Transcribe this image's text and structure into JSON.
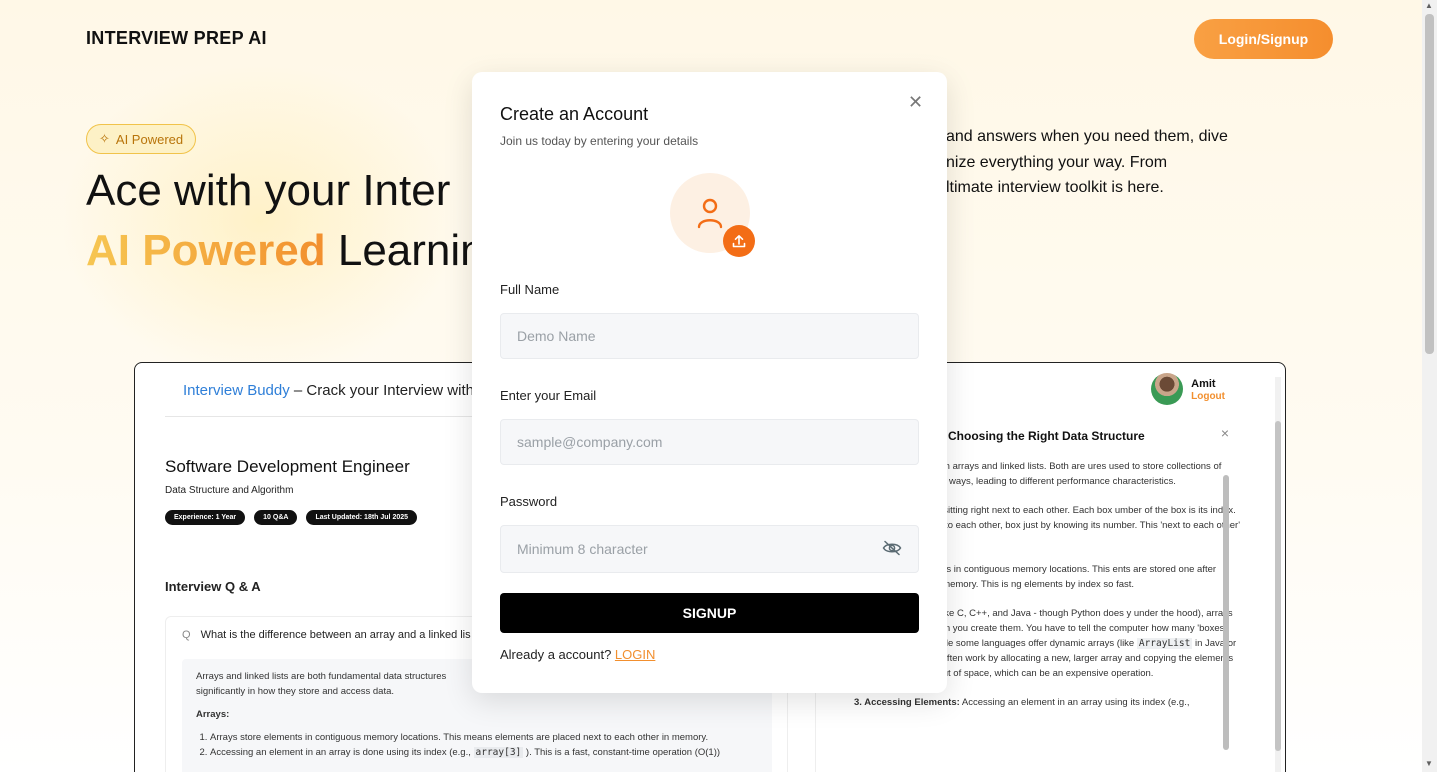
{
  "header": {
    "brand": "INTERVIEW PREP AI",
    "login_label": "Login/Signup"
  },
  "hero": {
    "badge": "AI Powered",
    "line1": "Ace with your Inter",
    "line2_accent": "AI Powered",
    "line2_rest": " Learnin",
    "desc_line1": "and answers when you need them, dive",
    "desc_line2": "nize everything your way. From",
    "desc_line3": "ltimate interview toolkit is here."
  },
  "preview": {
    "logo_blue": "Interview Buddy",
    "logo_rest": " – Crack your Interview with",
    "user_name": "Amit",
    "logout": "Logout",
    "role_title": "Software Development Engineer",
    "topics": "Data Structure and Algorithm",
    "tags": [
      "Experience: 1 Year",
      "10 Q&A",
      "Last Updated: 18th Jul 2025"
    ],
    "qa_heading": "Interview Q & A",
    "question_prefix": "Q",
    "question": "What is the difference between an array and a linked lis",
    "answer_intro_1": "Arrays and linked lists are both fundamental data structures",
    "answer_intro_2": "significantly in how they store and access data.",
    "answer_arrays": "Arrays:",
    "answer_item1": "Arrays store elements in contiguous memory locations. This means elements are placed next to each other in memory.",
    "answer_item2_a": "Accessing an element in an array is done using its index (e.g.,",
    "answer_item2_code": "array[3]",
    "answer_item2_b": "). This is a fast, constant-time operation (O(1))",
    "panel_title": "Choosing the Right Data Structure",
    "panel_p1": "the difference between arrays and linked lists. Both are ures used to store collections of items, but they do it in ways, leading to different performance characteristics.",
    "panel_p2": "t of numbered boxes sitting right next to each other. Each box umber of the box is its index. Because they're next to each other, box just by knowing its number. This 'next to each other' part is",
    "panel_p3": ": Arrays store elements in contiguous memory locations. This ents are stored one after another in a block of memory. This is ng elements by index so fast.",
    "panel_p4_a": "In many languages (like C, C++, and Java - though Python does y under the hood), arrays have a fixed size when you create them. You have to tell the computer how many 'boxes' you want upfront. While some languages offer dynamic arrays (like",
    "panel_p4_code": "ArrayList",
    "panel_p4_b": "in Java or lists in Python), they often work by allocating a new, larger array and copying the elements over when they run out of space, which can be an expensive operation.",
    "panel_p5_label": "3. Accessing Elements:",
    "panel_p5": " Accessing an element in an array using its index (e.g.,"
  },
  "modal": {
    "title": "Create an Account",
    "subtitle": "Join us today by entering your details",
    "full_name_label": "Full Name",
    "full_name_placeholder": "Demo Name",
    "email_label": "Enter your Email",
    "email_placeholder": "sample@company.com",
    "password_label": "Password",
    "password_placeholder": "Minimum 8 character",
    "signup_label": "SIGNUP",
    "already_text": "Already a account? ",
    "login_link": "LOGIN"
  }
}
